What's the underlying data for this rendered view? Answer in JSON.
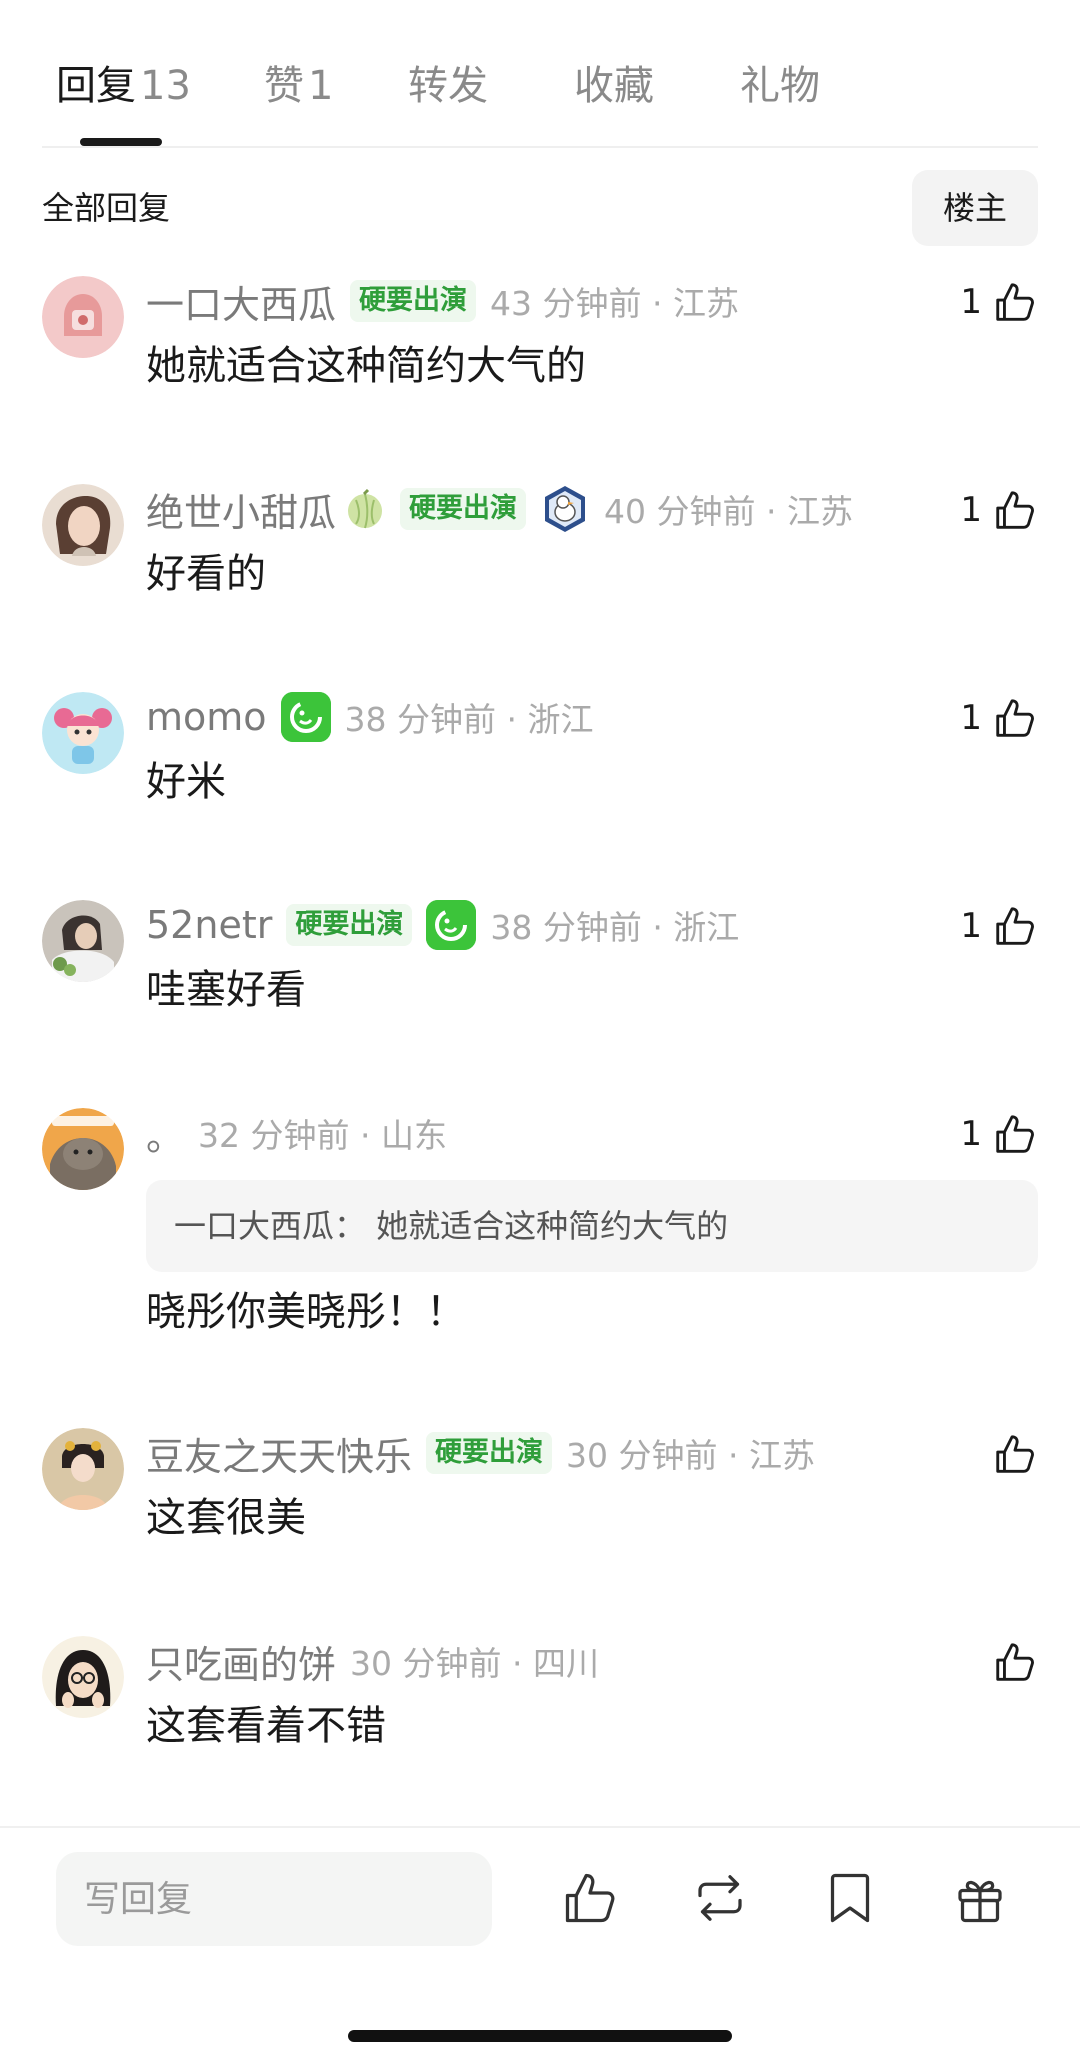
{
  "tabs": {
    "replies_label": "回复",
    "replies_count": "13",
    "likes_label": "赞",
    "likes_count": "1",
    "repost_label": "转发",
    "favorite_label": "收藏",
    "gift_label": "礼物"
  },
  "section": {
    "title": "全部回复",
    "op_filter": "楼主"
  },
  "comments": [
    {
      "user": "一口大西瓜",
      "badge": "硬要出演",
      "meta": "43 分钟前 · 江苏",
      "text": "她就适合这种简约大气的",
      "likes": "1"
    },
    {
      "user": "绝世小甜瓜",
      "badge": "硬要出演",
      "meta": "40 分钟前 · 江苏",
      "text": "好看的",
      "likes": "1"
    },
    {
      "user": "momo",
      "meta": "38 分钟前 · 浙江",
      "text": "好米",
      "likes": "1"
    },
    {
      "user": "52netr",
      "badge": "硬要出演",
      "meta": "38 分钟前 · 浙江",
      "text": "哇塞好看",
      "likes": "1"
    },
    {
      "user": "。",
      "meta": "32 分钟前 · 山东",
      "quote": "一口大西瓜：  她就适合这种简约大气的",
      "text": "晓彤你美晓彤！！",
      "likes": "1"
    },
    {
      "user": "豆友之天天快乐",
      "badge": "硬要出演",
      "meta": "30 分钟前 · 江苏",
      "text": "这套很美"
    },
    {
      "user": "只吃画的饼",
      "meta": "30 分钟前 · 四川",
      "text": "这套看着不错"
    }
  ],
  "bottom_bar": {
    "reply_placeholder": "写回复"
  },
  "icons": {
    "like": "thumbs-up-icon",
    "repost": "repost-icon",
    "favorite": "bookmark-icon",
    "gift": "gift-icon",
    "vip": "vip-smile-icon",
    "medal": "duck-medal-icon",
    "melon": "melon-icon"
  },
  "colors": {
    "badge_text": "#2f9e3a",
    "badge_bg": "#eef8ee",
    "vip_green": "#3cc43a",
    "meta_gray": "#aaaaaa"
  }
}
